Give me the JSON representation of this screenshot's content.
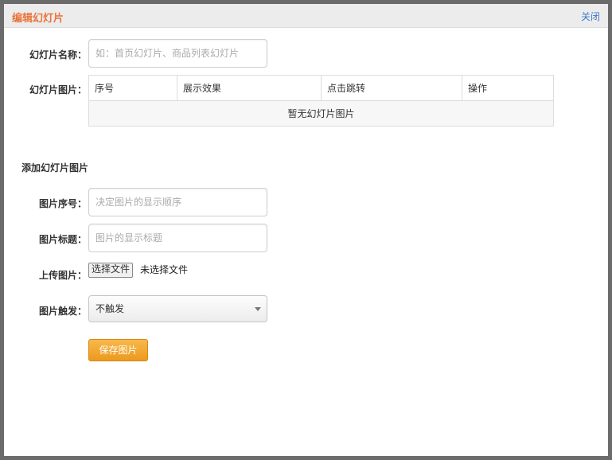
{
  "dialog": {
    "title": "编辑幻灯片",
    "close_label": "关闭"
  },
  "form": {
    "name_label": "幻灯片名称：",
    "name_placeholder": "如：首页幻灯片、商品列表幻灯片",
    "images_label": "幻灯片图片："
  },
  "table": {
    "headers": [
      "序号",
      "展示效果",
      "点击跳转",
      "操作"
    ],
    "empty_text": "暂无幻灯片图片"
  },
  "add_section": {
    "title": "添加幻灯片图片",
    "order_label": "图片序号：",
    "order_placeholder": "决定图片的显示顺序",
    "caption_label": "图片标题：",
    "caption_placeholder": "图片的显示标题",
    "upload_label": "上传图片：",
    "file_button": "选择文件",
    "file_status": "未选择文件",
    "trigger_label": "图片触发：",
    "trigger_value": "不触发",
    "save_label": "保存图片"
  }
}
